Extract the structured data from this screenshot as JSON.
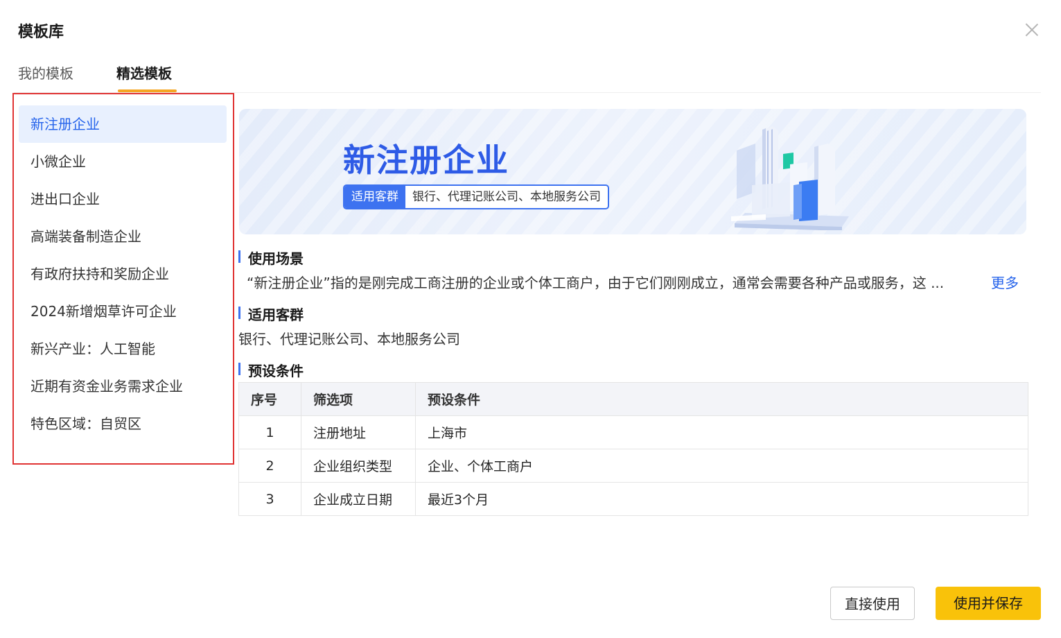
{
  "dialog": {
    "title": "模板库"
  },
  "tabs": [
    {
      "label": "我的模板",
      "active": false
    },
    {
      "label": "精选模板",
      "active": true
    }
  ],
  "sidebar": {
    "items": [
      {
        "label": "新注册企业",
        "active": true
      },
      {
        "label": "小微企业",
        "active": false
      },
      {
        "label": "进出口企业",
        "active": false
      },
      {
        "label": "高端装备制造企业",
        "active": false
      },
      {
        "label": "有政府扶持和奖励企业",
        "active": false
      },
      {
        "label": "2024新增烟草许可企业",
        "active": false
      },
      {
        "label": "新兴产业：人工智能",
        "active": false
      },
      {
        "label": "近期有资金业务需求企业",
        "active": false
      },
      {
        "label": "特色区域：自贸区",
        "active": false
      }
    ]
  },
  "banner": {
    "title": "新注册企业",
    "tag_label": "适用客群",
    "tag_value": "银行、代理记账公司、本地服务公司"
  },
  "sections": {
    "scenario": {
      "title": "使用场景",
      "text": "“新注册企业”指的是刚完成工商注册的企业或个体工商户，由于它们刚刚成立，通常会需要各种产品或服务，这 ...",
      "more": "更多"
    },
    "customers": {
      "title": "适用客群",
      "text": "银行、代理记账公司、本地服务公司"
    },
    "conditions": {
      "title": "预设条件",
      "headers": [
        "序号",
        "筛选项",
        "预设条件"
      ],
      "rows": [
        [
          "1",
          "注册地址",
          "上海市"
        ],
        [
          "2",
          "企业组织类型",
          "企业、个体工商户"
        ],
        [
          "3",
          "企业成立日期",
          "最近3个月"
        ]
      ]
    }
  },
  "footer": {
    "direct_label": "直接使用",
    "save_label": "使用并保存"
  },
  "colors": {
    "accent": "#2563eb",
    "tab_indicator": "#f5a623",
    "primary_button": "#f9c20a",
    "highlight_border": "#e03333"
  },
  "icons": {
    "close": "close-icon"
  }
}
